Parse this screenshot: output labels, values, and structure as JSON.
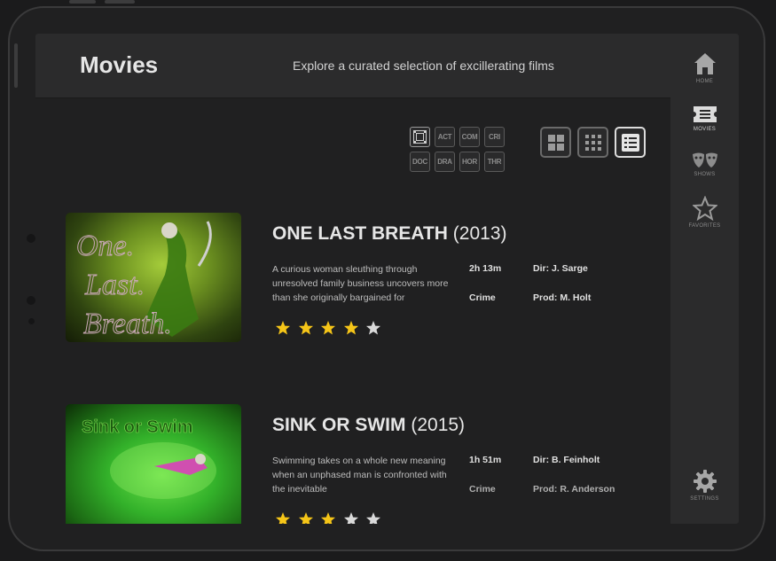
{
  "header": {
    "title": "Movies",
    "subtitle": "Explore a curated selection of excillerating films"
  },
  "nav": {
    "items": [
      {
        "label": "HOME",
        "icon": "home-icon"
      },
      {
        "label": "MOVIES",
        "icon": "ticket-icon"
      },
      {
        "label": "SHOWS",
        "icon": "masks-icon"
      },
      {
        "label": "FAVORITES",
        "icon": "star-icon"
      },
      {
        "label": "SETTINGS",
        "icon": "gear-icon"
      }
    ],
    "active": "MOVIES"
  },
  "filters": {
    "genres": [
      "ACT",
      "COM",
      "CRI",
      "DOC",
      "DRA",
      "HOR",
      "THR"
    ],
    "all_icon": "all-genres-icon"
  },
  "view_modes": [
    "large-grid",
    "small-grid",
    "list"
  ],
  "active_view": "list",
  "movies": [
    {
      "title": "ONE LAST BREATH",
      "year": "(2013)",
      "description": "A curious woman sleuthing through unresolved family business uncovers more than she originally bargained for",
      "runtime": "2h 13m",
      "genre": "Crime",
      "director": "Dir: J. Sarge",
      "producer": "Prod: M. Holt",
      "rating": 4,
      "poster_text": "One. Last. Breath."
    },
    {
      "title": "SINK OR SWIM",
      "year": "(2015)",
      "description": "Swimming takes on a whole new meaning when an unphased man is confronted with the inevitable",
      "runtime": "1h 51m",
      "genre": "Crime",
      "director": "Dir: B. Feinholt",
      "producer": "Prod: R. Anderson",
      "rating": 3,
      "poster_text": "Sink or Swim"
    }
  ],
  "colors": {
    "star_filled": "#f5c518",
    "star_empty": "#d9d9d9",
    "background": "#202021",
    "header": "#2b2b2c"
  }
}
